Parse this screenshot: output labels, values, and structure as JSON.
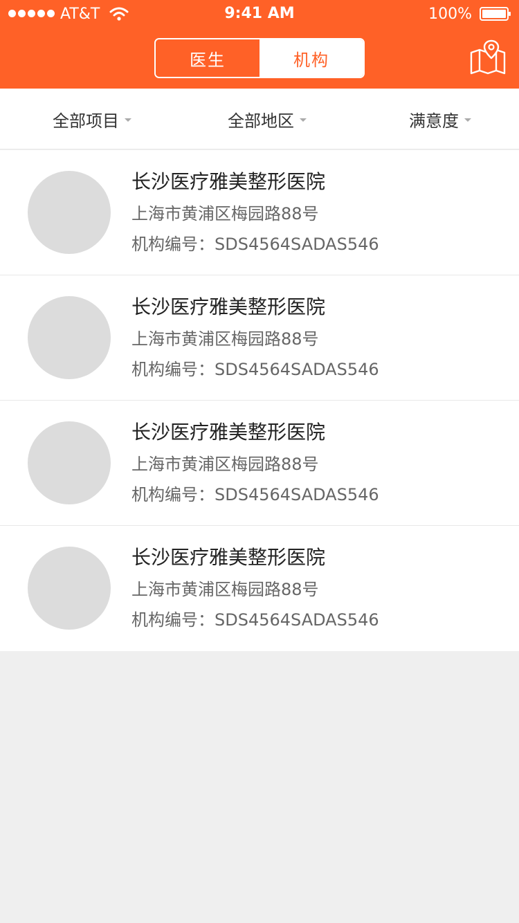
{
  "status_bar": {
    "carrier": "AT&T",
    "time": "9:41 AM",
    "battery": "100%"
  },
  "nav": {
    "tabs": [
      {
        "label": "医生",
        "active": false
      },
      {
        "label": "机构",
        "active": true
      }
    ],
    "map_icon": "map-pin-icon"
  },
  "filters": [
    {
      "label": "全部项目"
    },
    {
      "label": "全部地区"
    },
    {
      "label": "满意度"
    }
  ],
  "institutions": [
    {
      "name": "长沙医疗雅美整形医院",
      "address": "上海市黄浦区梅园路88号",
      "code_label": "机构编号：SDS4564SADAS546"
    },
    {
      "name": "长沙医疗雅美整形医院",
      "address": "上海市黄浦区梅园路88号",
      "code_label": "机构编号：SDS4564SADAS546"
    },
    {
      "name": "长沙医疗雅美整形医院",
      "address": "上海市黄浦区梅园路88号",
      "code_label": "机构编号：SDS4564SADAS546"
    },
    {
      "name": "长沙医疗雅美整形医院",
      "address": "上海市黄浦区梅园路88号",
      "code_label": "机构编号：SDS4564SADAS546"
    }
  ],
  "colors": {
    "accent": "#FF6127",
    "background": "#EFEFEF",
    "avatar_placeholder": "#DCDCDC"
  }
}
